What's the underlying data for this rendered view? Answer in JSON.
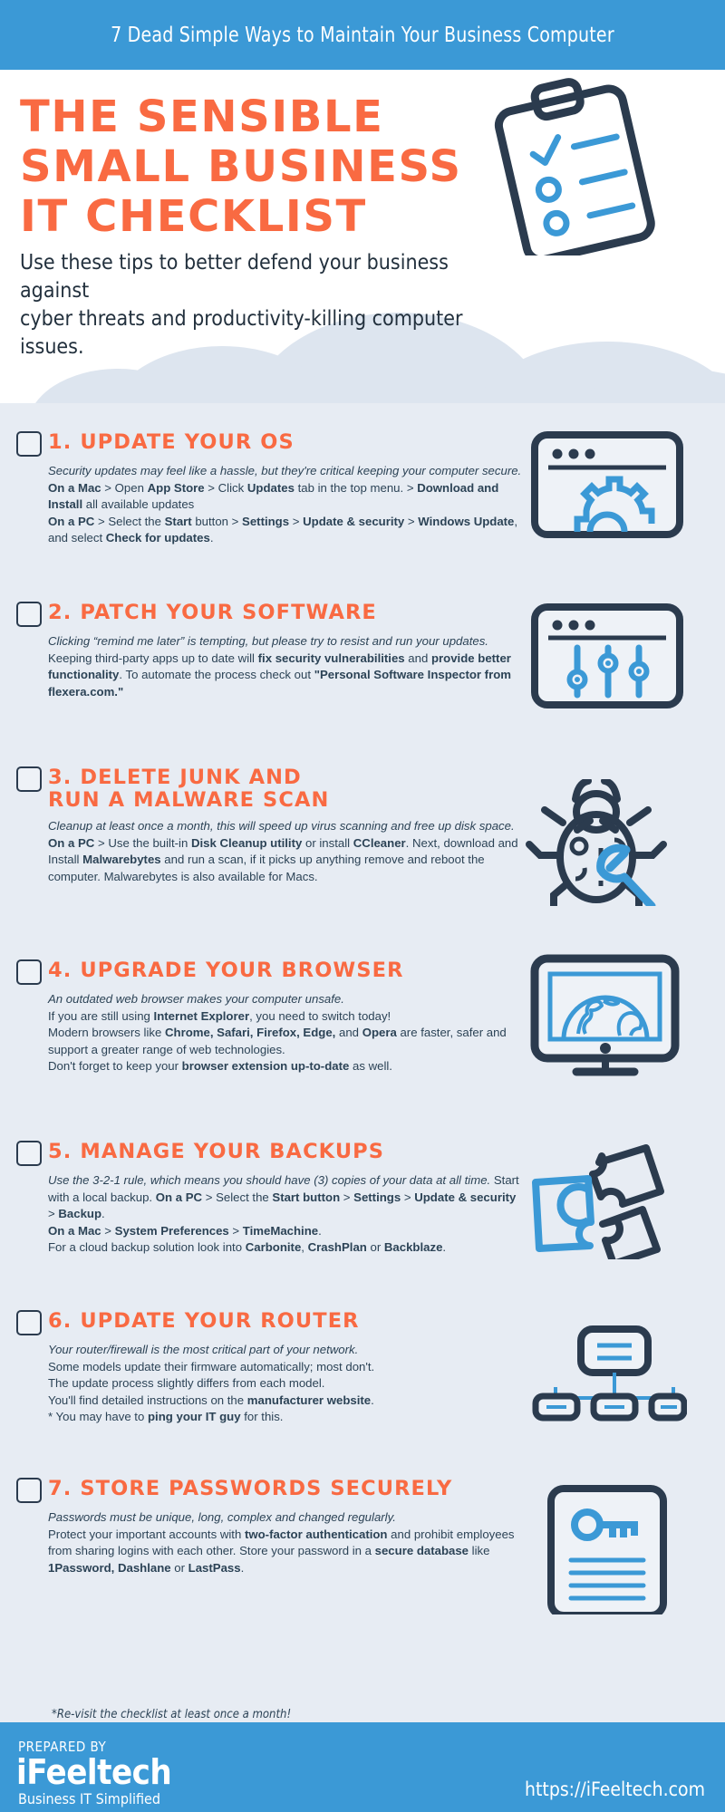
{
  "colors": {
    "brand_blue": "#3b99d6",
    "accent_orange": "#f96a42",
    "dark_navy": "#2b3b4e",
    "body_text": "#2c4356",
    "page_bg": "#e7ecf3",
    "cloud": "#dde5ef"
  },
  "topbar": {
    "title": "7 Dead Simple Ways to Maintain Your Business Computer"
  },
  "hero": {
    "title_line1": "THE SENSIBLE",
    "title_line2": "SMALL BUSINESS",
    "title_line3": "IT CHECKLIST",
    "subtitle_line1": "Use these tips to better defend your business against",
    "subtitle_line2": "cyber threats and productivity-killing computer issues.",
    "illustration": "clipboard-checklist-icon"
  },
  "items": [
    {
      "number": "1.",
      "title": "1. UPDATE YOUR OS",
      "icon": "browser-gear-icon",
      "lines": [
        [
          {
            "t": "Security updates may feel like a hassle, but they're critical keeping your computer secure. ",
            "s": "i"
          },
          {
            "t": "On a Mac",
            "s": "b"
          },
          {
            "t": " > Open ",
            "s": "n"
          },
          {
            "t": "App Store",
            "s": "b"
          },
          {
            "t": " > Click ",
            "s": "n"
          },
          {
            "t": "Updates",
            "s": "b"
          },
          {
            "t": " tab in the top menu. > ",
            "s": "n"
          },
          {
            "t": "Download and Install",
            "s": "b"
          },
          {
            "t": " all available updates",
            "s": "n"
          }
        ],
        [
          {
            "t": "On a PC",
            "s": "b"
          },
          {
            "t": " > Select the ",
            "s": "n"
          },
          {
            "t": "Start",
            "s": "b"
          },
          {
            "t": " button > ",
            "s": "n"
          },
          {
            "t": "Settings",
            "s": "b"
          },
          {
            "t": " > ",
            "s": "n"
          },
          {
            "t": "Update & security",
            "s": "b"
          },
          {
            "t": " > ",
            "s": "n"
          },
          {
            "t": "Windows Update",
            "s": "b"
          },
          {
            "t": ", and select ",
            "s": "n"
          },
          {
            "t": "Check for updates",
            "s": "b"
          },
          {
            "t": ".",
            "s": "n"
          }
        ]
      ]
    },
    {
      "number": "2.",
      "title": "2. PATCH YOUR SOFTWARE",
      "icon": "browser-sliders-icon",
      "lines": [
        [
          {
            "t": "Clicking “remind me later” is tempting, but please try to resist and run your updates.",
            "s": "i"
          }
        ],
        [
          {
            "t": "Keeping third-party apps up to date will ",
            "s": "n"
          },
          {
            "t": "fix security vulnerabilities",
            "s": "b"
          },
          {
            "t": " and ",
            "s": "n"
          },
          {
            "t": "provide better functionality",
            "s": "b"
          },
          {
            "t": ". To automate the process check out ",
            "s": "n"
          },
          {
            "t": "\"Personal Software Inspector from flexera.com.\"",
            "s": "b"
          }
        ]
      ]
    },
    {
      "number": "3.",
      "title": "3. DELETE JUNK AND RUN A MALWARE SCAN",
      "icon": "bug-wrench-icon",
      "lines": [
        [
          {
            "t": "Cleanup at least once a month, this will speed up virus scanning and free up disk space. ",
            "s": "i"
          },
          {
            "t": "On a PC",
            "s": "b"
          },
          {
            "t": " > Use the built-in ",
            "s": "n"
          },
          {
            "t": "Disk Cleanup utility",
            "s": "b"
          },
          {
            "t": " or install ",
            "s": "n"
          },
          {
            "t": "CCleaner",
            "s": "b"
          },
          {
            "t": ".  Next, download and Install ",
            "s": "n"
          },
          {
            "t": "Malwarebytes",
            "s": "b"
          },
          {
            "t": " and run a scan, if it picks up anything remove and reboot the computer. Malwarebytes is also available for Macs.",
            "s": "n"
          }
        ]
      ]
    },
    {
      "number": "4.",
      "title": "4. UPGRADE YOUR BROWSER",
      "icon": "monitor-globe-icon",
      "lines": [
        [
          {
            "t": "An outdated web browser makes your computer unsafe.",
            "s": "i"
          }
        ],
        [
          {
            "t": "If you are still using ",
            "s": "n"
          },
          {
            "t": "Internet Explorer",
            "s": "b"
          },
          {
            "t": ", you need to switch today!",
            "s": "n"
          }
        ],
        [
          {
            "t": "Modern browsers like ",
            "s": "n"
          },
          {
            "t": "Chrome, Safari, Firefox, Edge,",
            "s": "b"
          },
          {
            "t": " and ",
            "s": "n"
          },
          {
            "t": "Opera",
            "s": "b"
          },
          {
            "t": " are faster, safer and support a greater range of web technologies.",
            "s": "n"
          }
        ],
        [
          {
            "t": "Don't forget to keep your ",
            "s": "n"
          },
          {
            "t": "browser extension up-to-date",
            "s": "b"
          },
          {
            "t": " as well.",
            "s": "n"
          }
        ]
      ]
    },
    {
      "number": "5.",
      "title": "5. MANAGE YOUR BACKUPS",
      "icon": "puzzle-pieces-icon",
      "lines": [
        [
          {
            "t": "Use the 3-2-1 rule, which means you should have (3) copies of your data at all time. ",
            "s": "i"
          },
          {
            "t": "Start with a local backup. ",
            "s": "n"
          },
          {
            "t": "On a PC",
            "s": "b"
          },
          {
            "t": " > Select the ",
            "s": "n"
          },
          {
            "t": "Start button",
            "s": "b"
          },
          {
            "t": " > ",
            "s": "n"
          },
          {
            "t": "Settings",
            "s": "b"
          },
          {
            "t": " > ",
            "s": "n"
          },
          {
            "t": "Update & security",
            "s": "b"
          },
          {
            "t": " > ",
            "s": "n"
          },
          {
            "t": "Backup",
            "s": "b"
          },
          {
            "t": ".",
            "s": "n"
          }
        ],
        [
          {
            "t": "On a Mac",
            "s": "b"
          },
          {
            "t": " > ",
            "s": "n"
          },
          {
            "t": "System Preferences",
            "s": "b"
          },
          {
            "t": " > ",
            "s": "n"
          },
          {
            "t": "TimeMachine",
            "s": "b"
          },
          {
            "t": ".",
            "s": "n"
          }
        ],
        [
          {
            "t": "For a cloud backup solution look into ",
            "s": "n"
          },
          {
            "t": "Carbonite",
            "s": "b"
          },
          {
            "t": ", ",
            "s": "n"
          },
          {
            "t": "CrashPlan",
            "s": "b"
          },
          {
            "t": " or ",
            "s": "n"
          },
          {
            "t": "Backblaze",
            "s": "b"
          },
          {
            "t": ".",
            "s": "n"
          }
        ]
      ]
    },
    {
      "number": "6.",
      "title": "6. UPDATE YOUR ROUTER",
      "icon": "network-tree-icon",
      "lines": [
        [
          {
            "t": "Your router/firewall is the most critical part of your network.",
            "s": "i"
          }
        ],
        [
          {
            "t": "Some models update their firmware automatically; most don't.",
            "s": "n"
          }
        ],
        [
          {
            "t": "The update process slightly differs from each model.",
            "s": "n"
          }
        ],
        [
          {
            "t": "You'll find detailed instructions on the ",
            "s": "n"
          },
          {
            "t": "manufacturer website",
            "s": "b"
          },
          {
            "t": ".",
            "s": "n"
          }
        ],
        [
          {
            "t": "* You may have to ",
            "s": "n"
          },
          {
            "t": "ping your IT guy",
            "s": "b"
          },
          {
            "t": " for this.",
            "s": "n"
          }
        ]
      ]
    },
    {
      "number": "7.",
      "title": "7. STORE PASSWORDS SECURELY",
      "icon": "document-key-icon",
      "lines": [
        [
          {
            "t": "Passwords must be unique, long, complex and changed regularly.",
            "s": "i"
          }
        ],
        [
          {
            "t": "Protect your important accounts with ",
            "s": "n"
          },
          {
            "t": "two-factor authentication",
            "s": "b"
          },
          {
            "t": " and prohibit employees from sharing logins with each other. Store your password in a ",
            "s": "n"
          },
          {
            "t": "secure database",
            "s": "b"
          },
          {
            "t": " like ",
            "s": "n"
          },
          {
            "t": "1Password, Dashlane",
            "s": "b"
          },
          {
            "t": " or ",
            "s": "n"
          },
          {
            "t": "LastPass",
            "s": "b"
          },
          {
            "t": ".",
            "s": "n"
          }
        ]
      ]
    }
  ],
  "footnote": "*Re-visit the checklist at least once a month!",
  "footer": {
    "prepared_by": "PREPARED BY",
    "brand": "iFeeltech",
    "tagline": "Business IT Simplified",
    "url": "https://iFeeltech.com"
  }
}
